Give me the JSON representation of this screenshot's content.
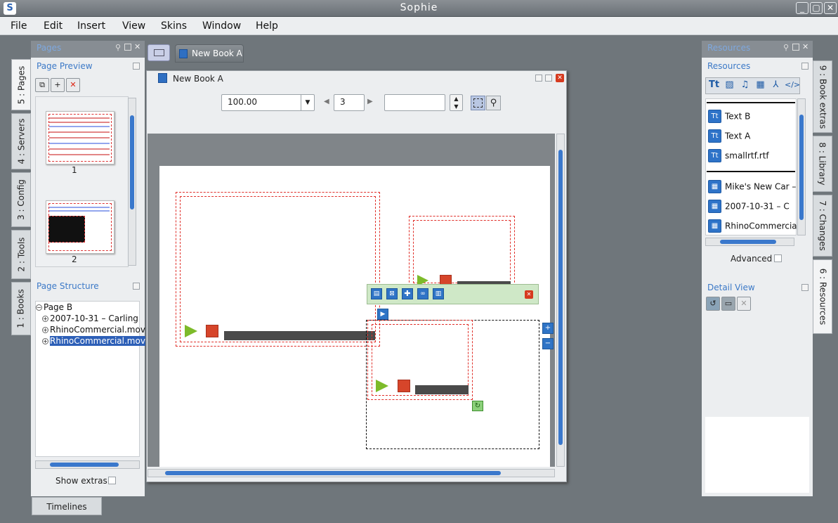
{
  "window": {
    "title": "Sophie"
  },
  "menu": [
    "File",
    "Edit",
    "Insert",
    "View",
    "Skins",
    "Window",
    "Help"
  ],
  "left_tabs": [
    "5 : Pages",
    "4 : Servers",
    "3 : Config",
    "2 : Tools",
    "1 : Books"
  ],
  "right_tabs": [
    "9 : Book extras",
    "8 : Library",
    "7 : Changes",
    "6 : Resources"
  ],
  "pages_panel": {
    "title": "Pages",
    "preview_title": "Page Preview",
    "thumbnails": [
      "1",
      "2"
    ],
    "structure_title": "Page Structure",
    "tree": [
      {
        "label": "Page B",
        "selected": false
      },
      {
        "label": "2007-10-31 – Carling",
        "selected": false
      },
      {
        "label": "RhinoCommercial.mov",
        "selected": false
      },
      {
        "label": "RhinoCommercial.mov",
        "selected": true
      }
    ],
    "show_extras": "Show extras",
    "timelines_tab": "Timelines"
  },
  "editor": {
    "doc_tab": "New Book A",
    "window_title": "New Book A",
    "zoom": "100.00",
    "page_number": "3",
    "search_value": ""
  },
  "resources_panel": {
    "title": "Resources",
    "inner_title": "Resources",
    "items_text": [
      "Text B",
      "Text A",
      "smallrtf.rtf"
    ],
    "items_media": [
      "Mike's New Car –",
      "2007-10-31 – C",
      "RhinoCommercial"
    ],
    "advanced": "Advanced",
    "detail_title": "Detail View"
  }
}
